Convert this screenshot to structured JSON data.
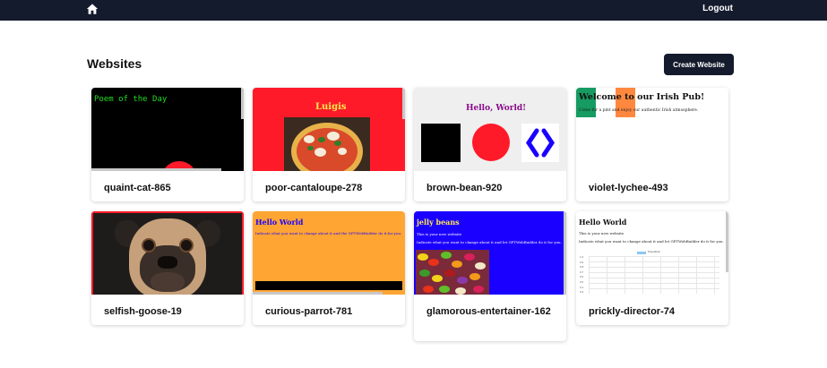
{
  "header": {
    "home_icon": "home-icon",
    "logout_label": "Logout"
  },
  "main": {
    "title": "Websites",
    "create_button_label": "Create Website"
  },
  "websites": [
    {
      "name": "quaint-cat-865",
      "preview": {
        "heading": "Poem of the Day"
      }
    },
    {
      "name": "poor-cantaloupe-278",
      "preview": {
        "heading": "Luigis"
      }
    },
    {
      "name": "brown-bean-920",
      "preview": {
        "heading": "Hello, World!"
      }
    },
    {
      "name": "violet-lychee-493",
      "preview": {
        "heading": "Welcome to our Irish Pub!",
        "body": "Come for a pint and enjoy our authentic Irish atmosphere."
      }
    },
    {
      "name": "selfish-goose-19",
      "preview": {}
    },
    {
      "name": "curious-parrot-781",
      "preview": {
        "heading": "Hello World",
        "body": "Indicate what you want to change about it and the GPTWebBuilder do it for you."
      }
    },
    {
      "name": "glamorous-entertainer-162",
      "preview": {
        "heading": "jelly beans",
        "line1": "This is your new website",
        "line2": "Indicate what you want to change about it and let GPTWebBuilder do it for you."
      }
    },
    {
      "name": "prickly-director-74",
      "preview": {
        "heading": "Hello World",
        "line1": "This is your new website",
        "line2": "Indicate what you want to change about it and let GPTWebBuilder do it for you.",
        "legend": "Population",
        "ticks": [
          "1.0",
          "0.9",
          "0.8",
          "0.7",
          "0.6",
          "0.5",
          "0.4",
          "0.3"
        ]
      }
    }
  ],
  "colors": {
    "nav_bg": "#141b2d",
    "button_bg": "#141b2d",
    "pizza_bg": "#ff1a2a",
    "jelly_bg": "#1a00ff",
    "parrot_bg": "#ffa533",
    "irish_green": "#169b62",
    "irish_orange": "#ff883e"
  }
}
